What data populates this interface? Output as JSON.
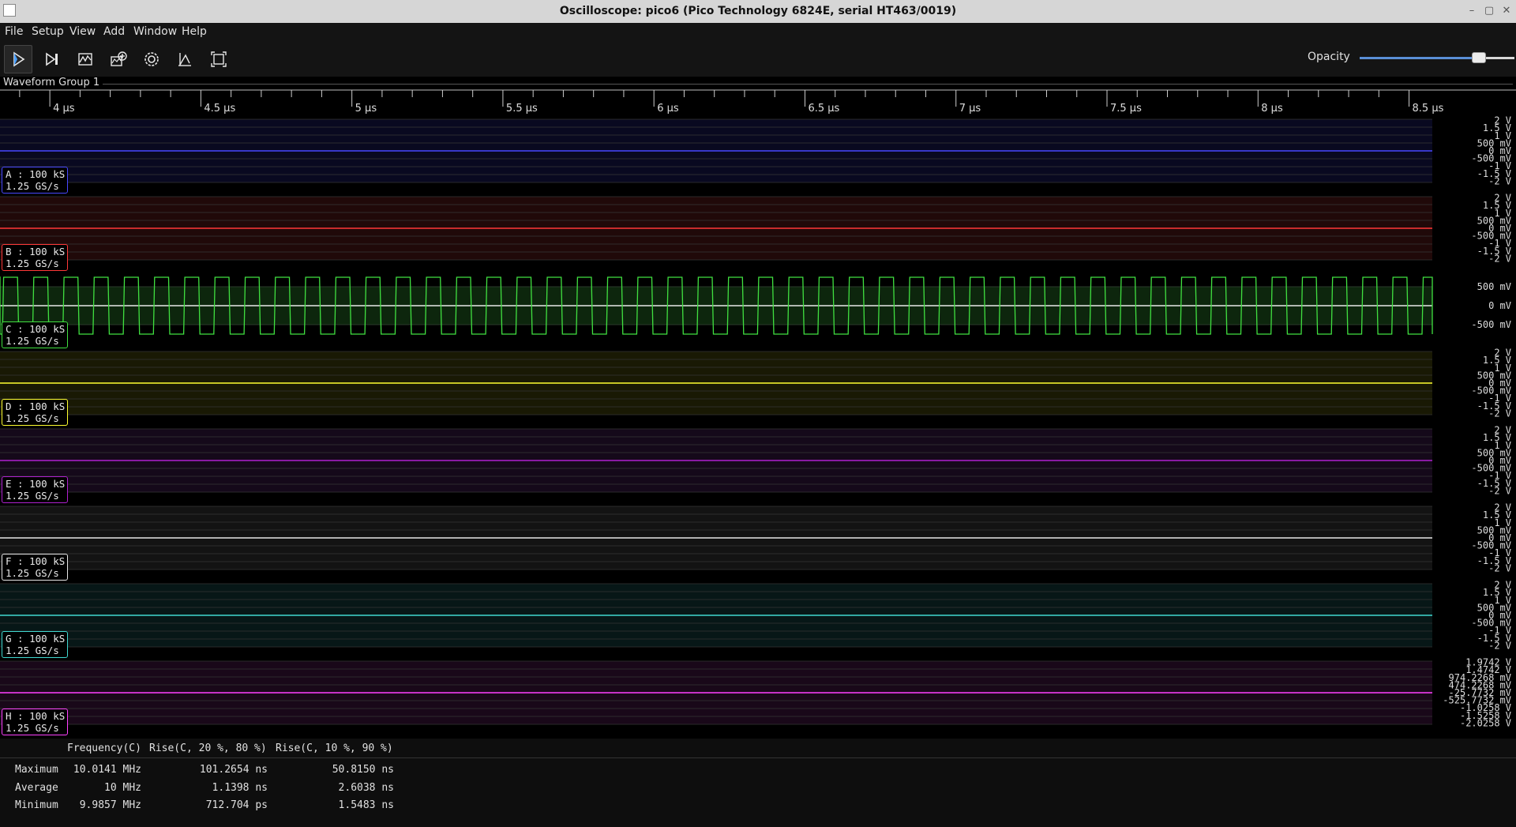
{
  "window": {
    "title": "Oscilloscope: pico6 (Pico Technology 6824E, serial HT463/0019)",
    "controls": [
      "–",
      "▢",
      "✕"
    ]
  },
  "menu": [
    "File",
    "Setup",
    "View",
    "Add",
    "Window",
    "Help"
  ],
  "toolbar": {
    "buttons": [
      "play-icon",
      "single-step-icon",
      "waveform-icon",
      "add-channel-icon",
      "settings-icon",
      "trigger-icon",
      "fullscreen-icon"
    ],
    "opacity_label": "Opacity",
    "opacity_value": 0.77
  },
  "group": {
    "title": "Waveform Group 1"
  },
  "timeline": {
    "unit": "µs",
    "start": 3.835,
    "end": 8.577,
    "major": [
      {
        "t": 4,
        "label": "4 µs"
      },
      {
        "t": 4.5,
        "label": "4.5 µs"
      },
      {
        "t": 5,
        "label": "5 µs"
      },
      {
        "t": 5.5,
        "label": "5.5 µs"
      },
      {
        "t": 6,
        "label": "6 µs"
      },
      {
        "t": 6.5,
        "label": "6.5 µs"
      },
      {
        "t": 7,
        "label": "7 µs"
      },
      {
        "t": 7.5,
        "label": "7.5 µs"
      },
      {
        "t": 8,
        "label": "8 µs"
      },
      {
        "t": 8.5,
        "label": "8.5 µs"
      }
    ]
  },
  "channels": [
    {
      "id": "A",
      "line1": "A : 100 kS",
      "line2": "1.25 GS/s",
      "color": "#4848ff",
      "band": "#10103a",
      "axis": [
        "2 V",
        "1.5 V",
        "1 V",
        "500 mV",
        "0 mV",
        "-500 mV",
        "-1 V",
        "-1.5 V",
        "-2 V"
      ],
      "trace": "flat"
    },
    {
      "id": "B",
      "line1": "B : 100 kS",
      "line2": "1.25 GS/s",
      "color": "#ff3838",
      "band": "#3a1010",
      "axis": [
        "2 V",
        "1.5 V",
        "1 V",
        "500 mV",
        "0 mV",
        "-500 mV",
        "-1 V",
        "-1.5 V",
        "-2 V"
      ],
      "trace": "flat"
    },
    {
      "id": "C",
      "line1": "C : 100 kS",
      "line2": "1.25 GS/s",
      "color": "#40e040",
      "band": "#0e2a0e",
      "axis": [
        "500 mV",
        "0 mV",
        "-500 mV"
      ],
      "trace": "square",
      "frequency_mhz": 10
    },
    {
      "id": "D",
      "line1": "D : 100 kS",
      "line2": "1.25 GS/s",
      "color": "#ffff30",
      "band": "#2e2e08",
      "axis": [
        "2 V",
        "1.5 V",
        "1 V",
        "500 mV",
        "0 mV",
        "-500 mV",
        "-1 V",
        "-1.5 V",
        "-2 V"
      ],
      "trace": "flat"
    },
    {
      "id": "E",
      "line1": "E : 100 kS",
      "line2": "1.25 GS/s",
      "color": "#b020d0",
      "band": "#261030",
      "axis": [
        "2 V",
        "1.5 V",
        "1 V",
        "500 mV",
        "0 mV",
        "-500 mV",
        "-1 V",
        "-1.5 V",
        "-2 V"
      ],
      "trace": "flat"
    },
    {
      "id": "F",
      "line1": "F : 100 kS",
      "line2": "1.25 GS/s",
      "color": "#e8e8e8",
      "band": "#222222",
      "axis": [
        "2 V",
        "1.5 V",
        "1 V",
        "500 mV",
        "0 mV",
        "-500 mV",
        "-1 V",
        "-1.5 V",
        "-2 V"
      ],
      "trace": "flat"
    },
    {
      "id": "G",
      "line1": "G : 100 kS",
      "line2": "1.25 GS/s",
      "color": "#40d8d0",
      "band": "#0c2a2a",
      "axis": [
        "2 V",
        "1.5 V",
        "1 V",
        "500 mV",
        "0 mV",
        "-500 mV",
        "-1 V",
        "-1.5 V",
        "-2 V"
      ],
      "trace": "flat"
    },
    {
      "id": "H",
      "line1": "H : 100 kS",
      "line2": "1.25 GS/s",
      "color": "#ff40ff",
      "band": "#2e0e2e",
      "axis": [
        "1.9742 V",
        "1.4742 V",
        "974.2268 mV",
        "474.2268 mV",
        "-25.7732 mV",
        "-525.7732 mV",
        "-1.0258 V",
        "-1.5258 V",
        "-2.0258 V"
      ],
      "trace": "flat"
    }
  ],
  "measurements": {
    "columns": [
      "Frequency(C)",
      "Rise(C, 20 %, 80 %)",
      "Rise(C, 10 %, 90 %)"
    ],
    "rows": [
      {
        "label": "Maximum",
        "values": [
          "10.0141 MHz",
          "101.2654 ns",
          "50.8150 ns"
        ]
      },
      {
        "label": "Average",
        "values": [
          "10 MHz",
          "1.1398 ns",
          "2.6038 ns"
        ]
      },
      {
        "label": "Minimum",
        "values": [
          "9.9857 MHz",
          "712.704 ps",
          "1.5483 ns"
        ]
      }
    ]
  }
}
